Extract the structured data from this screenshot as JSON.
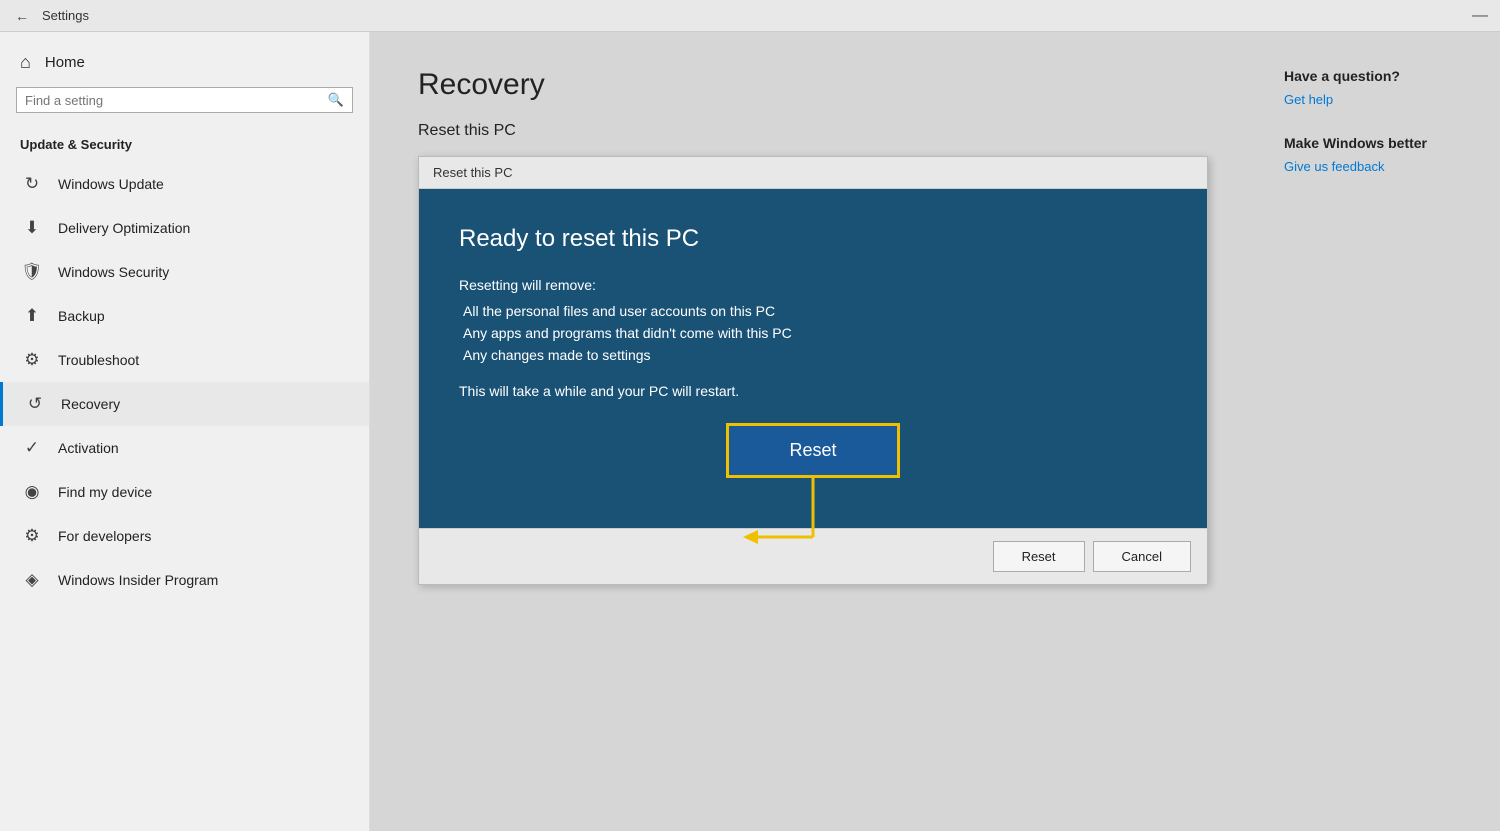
{
  "titlebar": {
    "back_icon": "←",
    "title": "Settings",
    "minimize_icon": "—"
  },
  "sidebar": {
    "home_label": "Home",
    "search_placeholder": "Find a setting",
    "section_title": "Update & Security",
    "items": [
      {
        "id": "windows-update",
        "label": "Windows Update",
        "icon": "↻"
      },
      {
        "id": "delivery-optimization",
        "label": "Delivery Optimization",
        "icon": "↓"
      },
      {
        "id": "windows-security",
        "label": "Windows Security",
        "icon": "🛡"
      },
      {
        "id": "backup",
        "label": "Backup",
        "icon": "↑"
      },
      {
        "id": "troubleshoot",
        "label": "Troubleshoot",
        "icon": "🔧"
      },
      {
        "id": "recovery",
        "label": "Recovery",
        "icon": "↺",
        "active": true
      },
      {
        "id": "activation",
        "label": "Activation",
        "icon": "✓"
      },
      {
        "id": "find-my-device",
        "label": "Find my device",
        "icon": "📍"
      },
      {
        "id": "for-developers",
        "label": "For developers",
        "icon": "⚙"
      },
      {
        "id": "windows-insider-program",
        "label": "Windows Insider Program",
        "icon": "👥"
      }
    ]
  },
  "main": {
    "page_title": "Recovery",
    "section_title": "Reset this PC",
    "dialog": {
      "titlebar": "Reset this PC",
      "heading": "Ready to reset this PC",
      "removing_label": "Resetting will remove:",
      "bullets": [
        "All the personal files and user accounts on this PC",
        "Any apps and programs that didn't come with this PC",
        "Any changes made to settings"
      ],
      "footer_note": "This will take a while and your PC will restart.",
      "big_reset_label": "Reset",
      "reset_label": "Reset",
      "cancel_label": "Cancel"
    }
  },
  "right_panel": {
    "question_heading": "Have a question?",
    "get_help_label": "Get help",
    "make_windows_heading": "Make Windows better",
    "feedback_label": "Give us feedback"
  }
}
